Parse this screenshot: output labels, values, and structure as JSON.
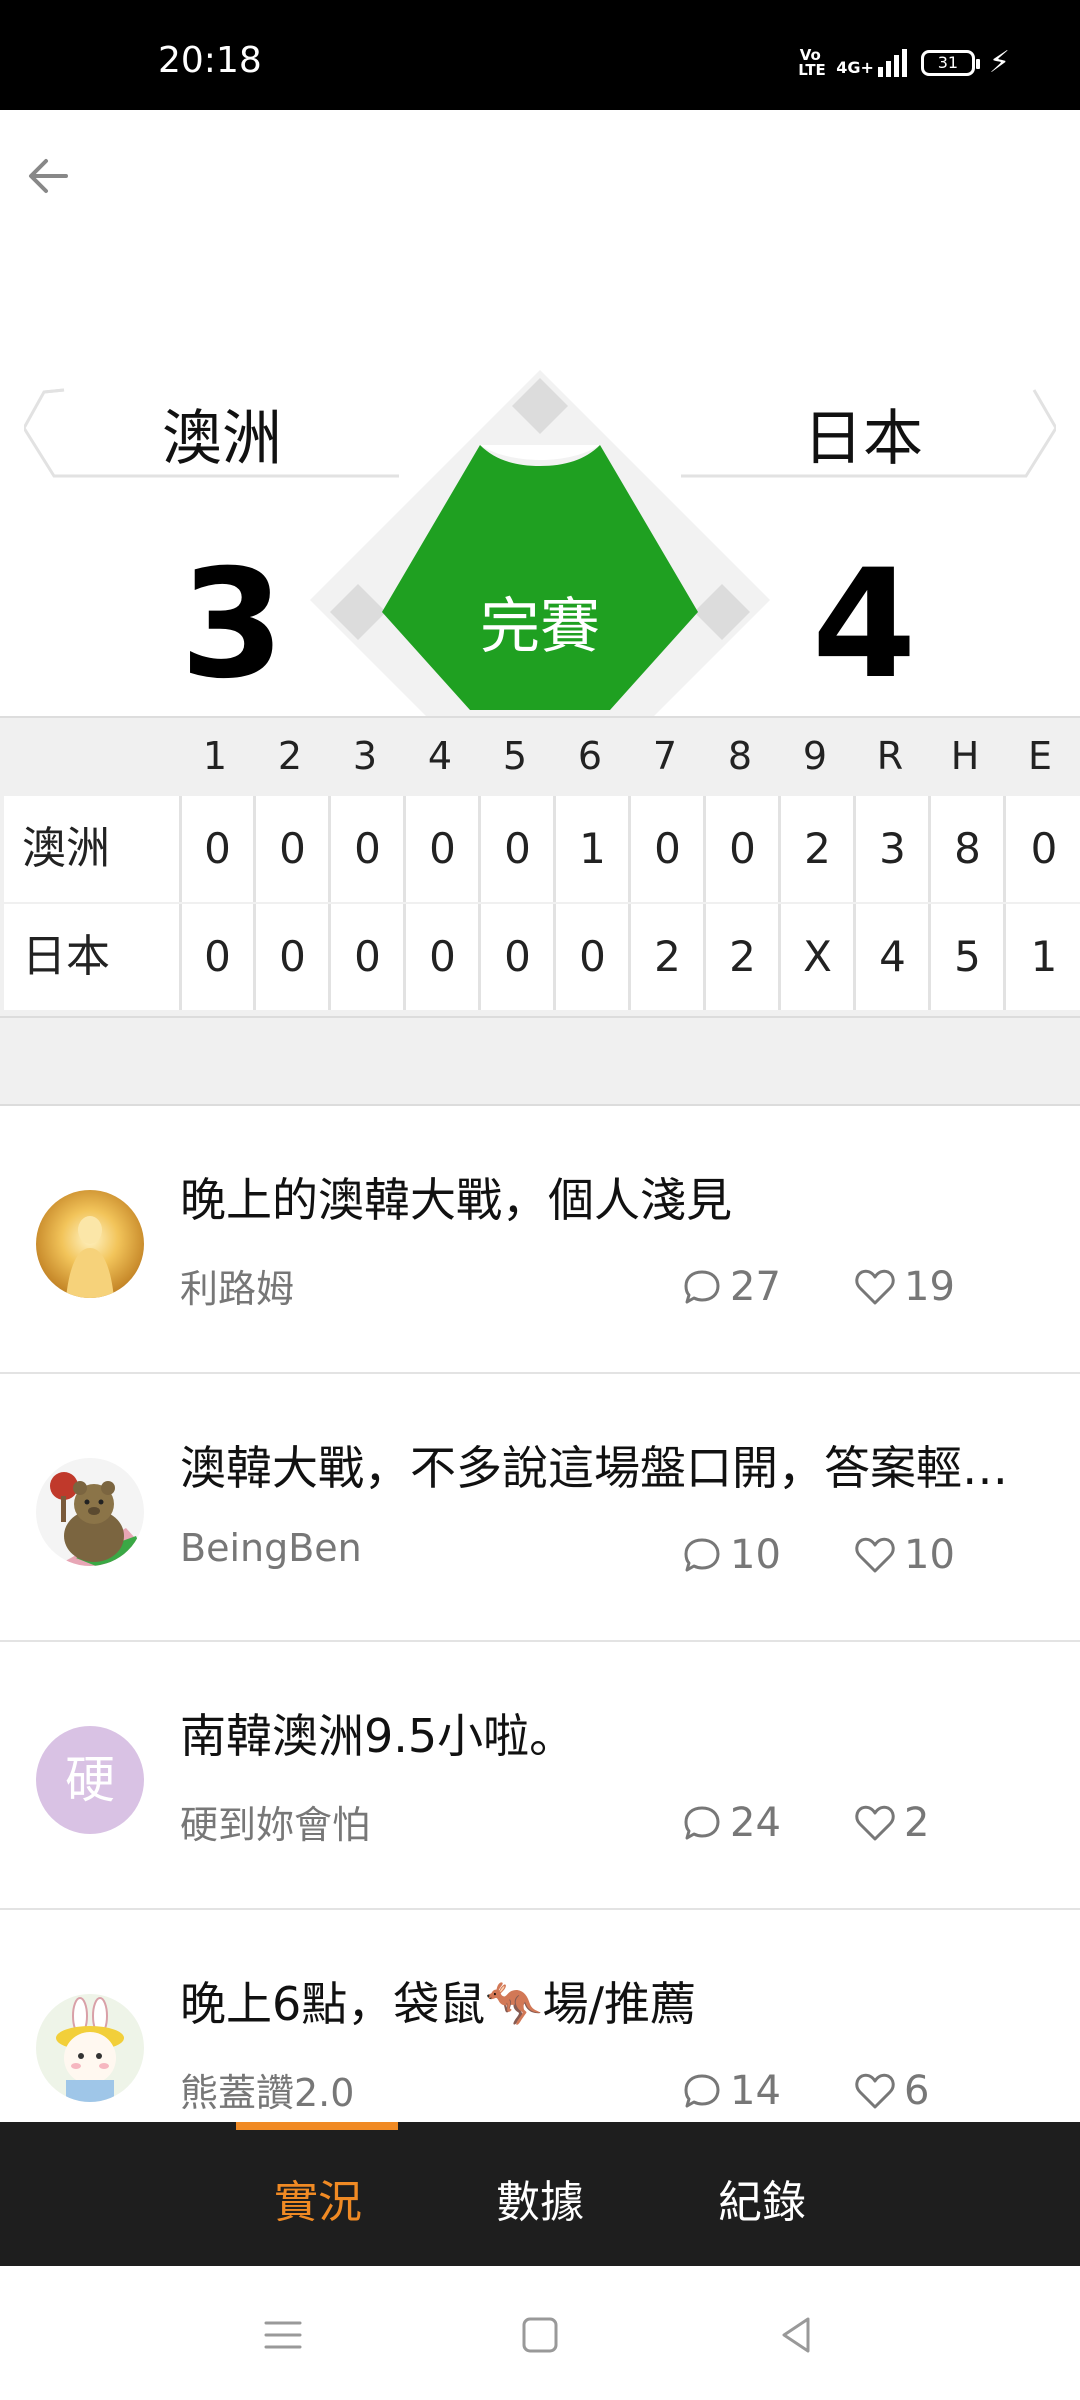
{
  "status_bar": {
    "time": "20:18",
    "volte": "Vo LTE",
    "network": "4G+",
    "battery": "31"
  },
  "game": {
    "home_team": "澳洲",
    "away_team": "日本",
    "home_score": "3",
    "away_score": "4",
    "status": "完賽",
    "status_color": "#1fa021"
  },
  "linescore": {
    "headers": [
      "1",
      "2",
      "3",
      "4",
      "5",
      "6",
      "7",
      "8",
      "9",
      "R",
      "H",
      "E"
    ],
    "rows": [
      {
        "team": "澳洲",
        "cells": [
          "0",
          "0",
          "0",
          "0",
          "0",
          "1",
          "0",
          "0",
          "2",
          "3",
          "8",
          "0"
        ]
      },
      {
        "team": "日本",
        "cells": [
          "0",
          "0",
          "0",
          "0",
          "0",
          "0",
          "2",
          "2",
          "X",
          "4",
          "5",
          "1"
        ]
      }
    ]
  },
  "posts": [
    {
      "title": "晚上的澳韓大戰，個人淺見",
      "author": "利路姆",
      "comments": "27",
      "likes": "19",
      "avatar": "golden-figure-avatar"
    },
    {
      "title": "澳韓大戰，不多說這場盤口開，答案輕…",
      "author": "BeingBen",
      "comments": "10",
      "likes": "10",
      "avatar": "bear-avatar"
    },
    {
      "title": "南韓澳洲9.5小啦。",
      "author": "硬到妳會怕",
      "comments": "24",
      "likes": "2",
      "avatar": "letter-avatar",
      "avatar_letter": "硬"
    },
    {
      "title": "晚上6點，袋鼠🦘場/推薦",
      "author": "熊蓋讚2.0",
      "comments": "14",
      "likes": "6",
      "avatar": "bunny-avatar"
    }
  ],
  "tabs": {
    "items": [
      "實況",
      "數據",
      "紀錄"
    ],
    "active": "實況",
    "accent": "#f08a24"
  }
}
